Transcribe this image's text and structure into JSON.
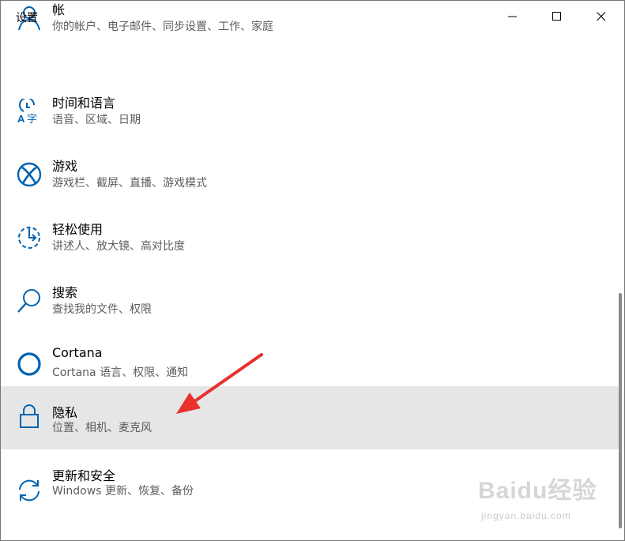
{
  "window": {
    "title": "设置"
  },
  "colors": {
    "accent": "#0063b1",
    "selected_bg": "#e6e6e6",
    "arrow": "#e8302c"
  },
  "items": [
    {
      "name": "帐",
      "desc": "你的帐户、电子邮件、同步设置、工作、家庭",
      "icon": "person-icon"
    },
    {
      "name": "时间和语言",
      "desc": "语音、区域、日期",
      "icon": "time-language-icon"
    },
    {
      "name": "游戏",
      "desc": "游戏栏、截屏、直播、游戏模式",
      "icon": "xbox-icon"
    },
    {
      "name": "轻松使用",
      "desc": "讲述人、放大镜、高对比度",
      "icon": "ease-of-access-icon"
    },
    {
      "name": "搜索",
      "desc": "查找我的文件、权限",
      "icon": "search-icon"
    },
    {
      "name": "Cortana",
      "desc": "Cortana 语言、权限、通知",
      "icon": "cortana-icon"
    },
    {
      "name": "隐私",
      "desc": "位置、相机、麦克风",
      "icon": "lock-icon"
    },
    {
      "name": "更新和安全",
      "desc": "Windows 更新、恢复、备份",
      "icon": "sync-icon"
    }
  ],
  "watermark": {
    "main": "Baidu经验",
    "sub": "jingyan.baidu.com"
  }
}
